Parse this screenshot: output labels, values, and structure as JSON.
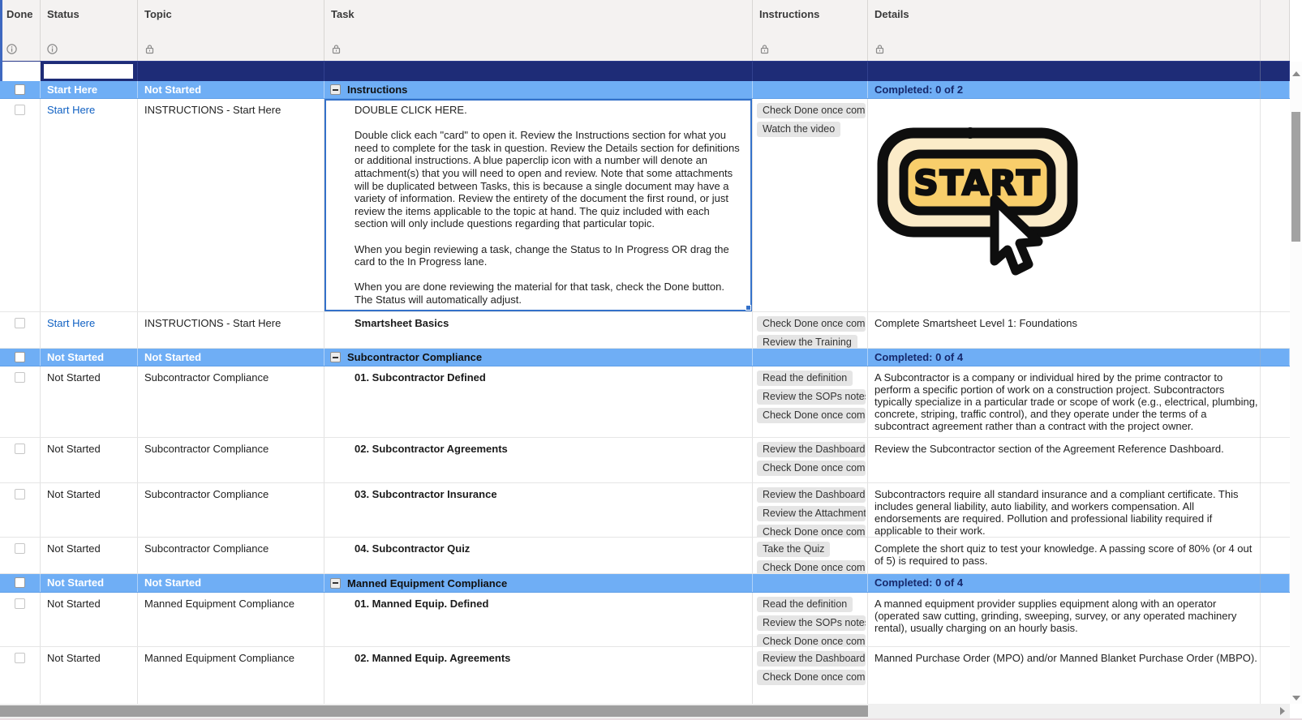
{
  "columns": [
    {
      "label": "Done",
      "icon": "info-icon"
    },
    {
      "label": "Status",
      "icon": "info-icon"
    },
    {
      "label": "Topic",
      "icon": "lock-icon"
    },
    {
      "label": "Task",
      "icon": "lock-icon"
    },
    {
      "label": "Instructions",
      "icon": "lock-icon"
    },
    {
      "label": "Details",
      "icon": "lock-icon"
    }
  ],
  "filter": {
    "status_value": ""
  },
  "start_graphic": {
    "text": "START"
  },
  "colors": {
    "group_row": "#6FAEF5",
    "filter_row": "#1E2C77",
    "link": "#1061C3",
    "selection": "#3471C9",
    "start_button_fill": "#F8CE6B",
    "start_button_ring": "#FBEBC8"
  },
  "rows": [
    {
      "type": "group",
      "status": "Start Here",
      "topic": "Not Started",
      "task": "Instructions",
      "completed": "Completed: 0 of 2"
    },
    {
      "type": "item",
      "status": "Start Here",
      "topic": "INSTRUCTIONS - Start Here",
      "task": "DOUBLE CLICK HERE.\n\nDouble click each \"card\" to open it. Review the Instructions section for what you need to complete for the task in question. Review the Details section for definitions or additional instructions. A blue paperclip icon with a number will denote an attachment(s) that you will need to open and review. Note that some attachments will be duplicated between Tasks, this is because a single document may have a variety of information. Review the entirety of the document the first round, or just review the items applicable to the topic at hand. The quiz included with each section will only include questions regarding that particular topic.\n\nWhen you begin reviewing a task, change the Status to In Progress OR drag the card to the In Progress lane.\n\nWhen you are done reviewing the material for that task, check the Done button. The Status will automatically adjust.",
      "instructions": [
        "Check Done once complete",
        "Watch the video"
      ],
      "details": ""
    },
    {
      "type": "item",
      "status": "Start Here",
      "topic": "INSTRUCTIONS - Start Here",
      "task": "Smartsheet Basics",
      "instructions": [
        "Check Done once complete",
        "Review the Training"
      ],
      "details": "Complete Smartsheet Level 1: Foundations"
    },
    {
      "type": "group",
      "status": "Not Started",
      "topic": "Not Started",
      "task": "Subcontractor Compliance",
      "completed": "Completed: 0 of 4"
    },
    {
      "type": "item",
      "status": "Not Started",
      "topic": "Subcontractor Compliance",
      "task": "01. Subcontractor Defined",
      "instructions": [
        "Read the definition",
        "Review the SOPs notes",
        "Check Done once complete"
      ],
      "details": "A Subcontractor is a company or individual hired by the prime contractor to perform a specific portion of work on a construction project. Subcontractors typically specialize in a particular trade or scope of work (e.g., electrical, plumbing, concrete, striping, traffic control), and they operate under the terms of a subcontract agreement rather than a contract with the project owner."
    },
    {
      "type": "item",
      "status": "Not Started",
      "topic": "Subcontractor Compliance",
      "task": "02. Subcontractor Agreements",
      "instructions": [
        "Review the Dashboard",
        "Check Done once complete"
      ],
      "details": "Review the Subcontractor section of the Agreement Reference Dashboard."
    },
    {
      "type": "item",
      "status": "Not Started",
      "topic": "Subcontractor Compliance",
      "task": "03. Subcontractor Insurance",
      "instructions": [
        "Review the Dashboard",
        "Review the Attachments",
        "Check Done once complete"
      ],
      "details": "Subcontractors require all standard insurance and a compliant certificate. This includes general liability, auto liability, and workers compensation. All endorsements are required. Pollution and professional liability required if applicable to their work."
    },
    {
      "type": "item",
      "status": "Not Started",
      "topic": "Subcontractor Compliance",
      "task": "04. Subcontractor Quiz",
      "instructions": [
        "Take the Quiz",
        "Check Done once complete"
      ],
      "details": "Complete the short quiz to test your knowledge. A passing score of 80% (or 4 out of 5) is required to pass."
    },
    {
      "type": "group",
      "status": "Not Started",
      "topic": "Not Started",
      "task": "Manned Equipment Compliance",
      "completed": "Completed: 0 of 4"
    },
    {
      "type": "item",
      "status": "Not Started",
      "topic": "Manned Equipment Compliance",
      "task": "01. Manned Equip. Defined",
      "instructions": [
        "Read the definition",
        "Review the SOPs notes",
        "Check Done once complete"
      ],
      "details": "A manned equipment provider supplies equipment along with an operator (operated saw cutting, grinding, sweeping, survey, or any operated machinery rental), usually charging on an hourly basis."
    },
    {
      "type": "item",
      "status": "Not Started",
      "topic": "Manned Equipment Compliance",
      "task": "02. Manned Equip. Agreements",
      "instructions": [
        "Review the Dashboard",
        "Check Done once complete"
      ],
      "details": "Manned Purchase Order (MPO) and/or Manned Blanket Purchase Order (MBPO)."
    }
  ]
}
